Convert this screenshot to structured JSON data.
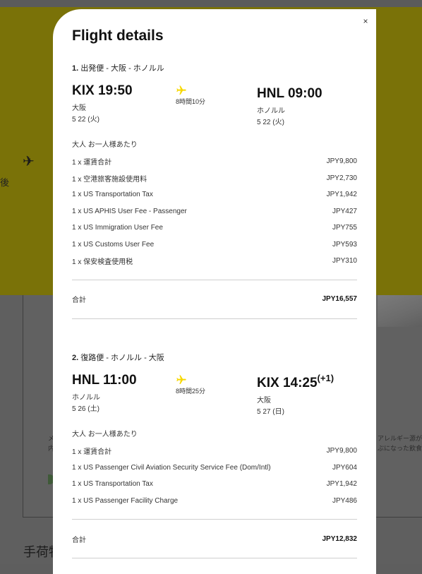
{
  "background": {
    "side_char": "後",
    "right_text_lines": [
      "アレルギー源が含",
      "ぶになった飲食物"
    ],
    "left_frag_lines": [
      "メ",
      "内"
    ],
    "bottom_text": "手荷物"
  },
  "modal": {
    "title": "Flight details",
    "close_label": "×",
    "segments": [
      {
        "number": "1.",
        "label": "出発便 - 大阪 - ホノルル",
        "from": {
          "code_time": "KIX 19:50",
          "city": "大阪",
          "date": "5 22 (火)"
        },
        "duration": "8時間10分",
        "to": {
          "code_time": "HNL 09:00",
          "plus": "",
          "city": "ホノルル",
          "date": "5 22 (火)"
        },
        "pax_label": "大人 お一人様あたり",
        "fees": [
          {
            "name": "1 x 運賃合計",
            "amount": "JPY9,800"
          },
          {
            "name": "1 x 空港旅客施設使用料",
            "amount": "JPY2,730"
          },
          {
            "name": "1 x US Transportation Tax",
            "amount": "JPY1,942"
          },
          {
            "name": "1 x US APHIS User Fee - Passenger",
            "amount": "JPY427"
          },
          {
            "name": "1 x US Immigration User Fee",
            "amount": "JPY755"
          },
          {
            "name": "1 x US Customs User Fee",
            "amount": "JPY593"
          },
          {
            "name": "1 x 保安検査使用税",
            "amount": "JPY310"
          }
        ],
        "total_label": "合計",
        "total_amount": "JPY16,557"
      },
      {
        "number": "2.",
        "label": "復路便 - ホノルル - 大阪",
        "from": {
          "code_time": "HNL 11:00",
          "city": "ホノルル",
          "date": "5 26 (土)"
        },
        "duration": "8時間25分",
        "to": {
          "code_time": "KIX 14:25",
          "plus": "(+1)",
          "city": "大阪",
          "date": "5 27 (日)"
        },
        "pax_label": "大人 お一人様あたり",
        "fees": [
          {
            "name": "1 x 運賃合計",
            "amount": "JPY9,800"
          },
          {
            "name": "1 x US Passenger Civil Aviation Security Service Fee (Dom/Intl)",
            "amount": "JPY604"
          },
          {
            "name": "1 x US Transportation Tax",
            "amount": "JPY1,942"
          },
          {
            "name": "1 x US Passenger Facility Charge",
            "amount": "JPY486"
          }
        ],
        "total_label": "合計",
        "total_amount": "JPY12,832"
      }
    ]
  },
  "colors": {
    "accent_yellow": "#f7d800",
    "overlay_yellow": "#7a7208"
  },
  "icons": {
    "plane": "plane-icon",
    "close": "close-icon"
  }
}
